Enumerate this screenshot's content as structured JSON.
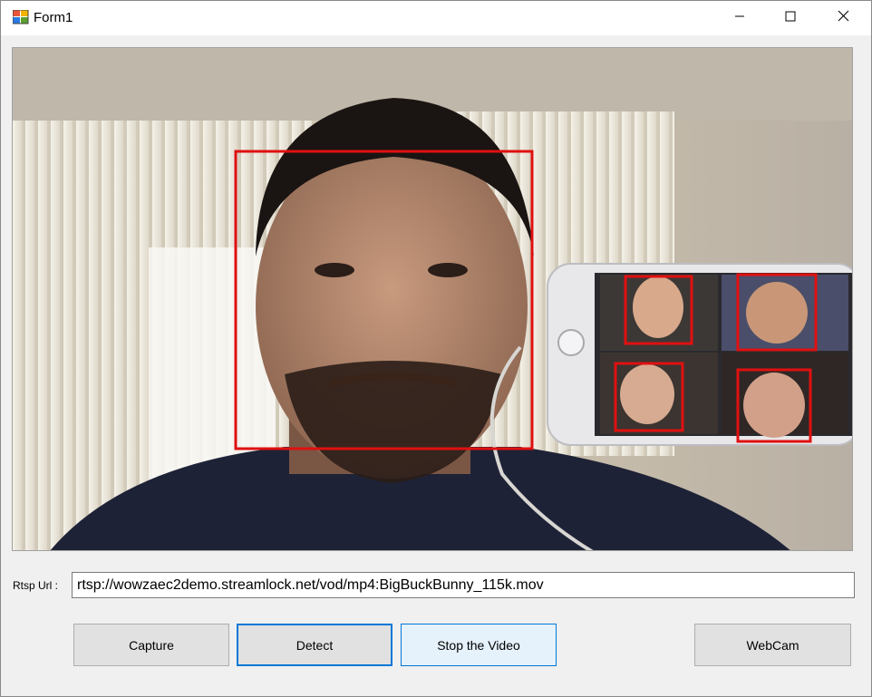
{
  "window": {
    "title": "Form1",
    "icons": {
      "app": "windows-form-icon",
      "minimize": "minimize-icon",
      "maximize": "maximize-icon",
      "close": "close-icon"
    }
  },
  "video": {
    "detection_color": "#e01010"
  },
  "rtsp": {
    "label": "Rtsp Url :",
    "value": "rtsp://wowzaec2demo.streamlock.net/vod/mp4:BigBuckBunny_115k.mov"
  },
  "buttons": {
    "capture": "Capture",
    "detect": "Detect",
    "stop": "Stop the Video",
    "webcam": "WebCam"
  },
  "colors": {
    "accent": "#0078d7",
    "button_bg": "#e1e1e1",
    "window_bg": "#f0f0f0"
  }
}
